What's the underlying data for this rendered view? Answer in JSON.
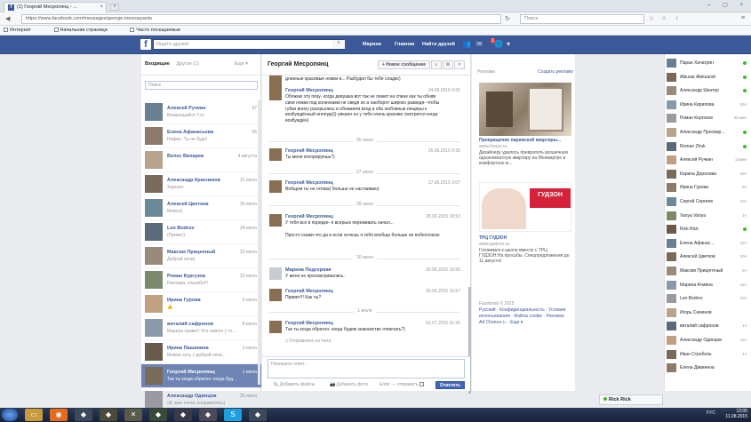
{
  "browser": {
    "tab_title": "(1) Георгий Месропянц - ...",
    "tab_close": "×",
    "new_tab": "+",
    "window_controls": "– ▢ ×",
    "url": "https://www.facebook.com/messages/george.mesropyants",
    "search_placeholder": "Поиск",
    "bookmarks": [
      "Интернет",
      "Начальная страница",
      "Часто посещаемые"
    ]
  },
  "fb": {
    "logo": "f",
    "search_placeholder": "Ищите друзей",
    "nav": [
      "Марина",
      "Главная",
      "Найти друзей"
    ],
    "notif_count": "1"
  },
  "inbox": {
    "tab_inbox": "Входящие",
    "tab_other": "Другое (1)",
    "more": "Еще ▾",
    "search_placeholder": "Поиск",
    "threads": [
      {
        "name": "Алексей Ручкин",
        "snippet": "Возвращайся 7-го",
        "date": "07"
      },
      {
        "name": "Елена Афанасьева",
        "snippet": "Нафис: Ты не будь!",
        "date": "06"
      },
      {
        "name": "Велес Вихарев",
        "snippet": "",
        "date": "4 августа"
      },
      {
        "name": "Александр Красников",
        "snippet": "Хорошо",
        "date": "31 июля"
      },
      {
        "name": "Алексей Цветков",
        "snippet": "Можно)",
        "date": "30 июля"
      },
      {
        "name": "Leo Bodrov",
        "snippet": "(Привет)",
        "date": "24 июля"
      },
      {
        "name": "Максим Прицепный",
        "snippet": "Доброй ночи)",
        "date": "23 июля"
      },
      {
        "name": "Роман Кургузов",
        "snippet": "Реклама, спасибо!!!",
        "date": "23 июля"
      },
      {
        "name": "Ирина Гурова",
        "snippet": "👍",
        "date": "9 июля"
      },
      {
        "name": "виталий сафронов",
        "snippet": "Марина привет! Что нового у те...",
        "date": "8 июля"
      },
      {
        "name": "Ирина Пашинина",
        "snippet": "Можно хоть с доброй ночи...",
        "date": "3 июля"
      },
      {
        "name": "Георгий Месропянц",
        "snippet": "Так ты когда обратно- когда буд...",
        "date": "1 июля"
      },
      {
        "name": "Александр Одинцов",
        "snippet": "ой, мне очень понравилось)",
        "date": "25 июня"
      }
    ]
  },
  "conversation": {
    "title": "Георгий Месропянц",
    "new_message": "+ Новое сообщение",
    "top_text": "длинные красивые ножки и... Разбудил бы тебя сладко)",
    "messages": [
      {
        "from": "Георгий Месропянц",
        "time": "24.06.2015 9:55",
        "text": "Обожаю эту позу- когда девушка вот так не лежит на спине как ты обняв свои ножки под коленками не сведя их а наоборот широко разведя- чтобы губки вниху раскрылись и обнажили вход в оба любовные пещеры к возбуждённый ингогда))) уверен он у тебя очень красиво смотрится когда возбуждён)"
      },
      {
        "from": "Георгий Месропянц",
        "time": "26.06.2015 9:35",
        "text": "Ты меня игнорируешь?)"
      },
      {
        "from": "Георгий Месропянц",
        "time": "27.06.2015 3:07",
        "text": "Вобщем ты не готова) больше не настаиваю)"
      },
      {
        "from": "Георгий Месропянц",
        "time": "28.06.2015 18:53",
        "text": "У тебя все в порядке- я всерьез переживать начал...\n\nПросто скажи что да и если хочешь я тебя вообще больше не побеспокою"
      },
      {
        "from": "Марина Подгорная",
        "time": "30.06.2015 16:50",
        "text": "У меня не просматривались."
      },
      {
        "from": "Георгий Месропянц",
        "time": "30.06.2015 16:57",
        "text": "Привет!!! Как ты?"
      },
      {
        "from": "Георгий Месропянц",
        "time": "01.07.2015 21:41",
        "text": "Так ты когда обратно- когда будем знакомство отмечать?)"
      }
    ],
    "separators": [
      "26 июня",
      "27 июня",
      "28 июня",
      "30 июня",
      "1 июля"
    ],
    "sent_from": "Отправлено из Чата",
    "compose_placeholder": "Напишите ответ...",
    "add_files": "Добавить файлы",
    "add_photo": "Добавить фото",
    "enter_send": "Enter — отправить",
    "send": "Ответить"
  },
  "ads": {
    "label": "Реклама",
    "create": "Создать рекламу",
    "ad1_title": "Превращение парижской квартиры...",
    "ad1_url": "www.houzz.ru",
    "ad1_text": "Дизайнеру удалось превратить крошечную однокомнатную квартиру на Монмартре в комфортное ж...",
    "ad2_brand": "ГУДЗОН",
    "ad2_title": "ТРЦ ГУДЗОН",
    "ad2_url": "www.gudzon.ru",
    "ad2_text": "Готовимся к школе вместе с ТРЦ ГУДЗОН.На просьбы. Спецпредложения до 11 августа!",
    "footer_copy": "Facebook © 2015",
    "footer_links": "Русский · Конфиденциальность · Условия использования · Файлы cookie · Реклама · Ad Choices ▷ · Еще ▾"
  },
  "chat": {
    "contacts": [
      {
        "name": "Паран Хачатрян",
        "status": "online"
      },
      {
        "name": "Albusar Aleksandr",
        "status": "online"
      },
      {
        "name": "Александр Шкатер",
        "status": "online"
      },
      {
        "name": "Ирина Кирилова",
        "status": "16ч"
      },
      {
        "name": "Роман Коргозов",
        "status": "35 мин"
      },
      {
        "name": "Александр Просвир...",
        "status": "online"
      },
      {
        "name": "Roman Zhuk",
        "status": "online"
      },
      {
        "name": "Алексей Ручкин",
        "status": "12мин"
      },
      {
        "name": "Карина Доронова",
        "status": "16ч"
      },
      {
        "name": "Ирина Гурова",
        "status": "6ч"
      },
      {
        "name": "Сергей Сергеев",
        "status": "10ч"
      },
      {
        "name": "Vanya Vanya",
        "status": "1ч"
      },
      {
        "name": "Rick Rick",
        "status": "online"
      },
      {
        "name": "Елена Афанас...",
        "status": "12ч"
      },
      {
        "name": "Алексей Цветков",
        "status": "10ч"
      },
      {
        "name": "Максим Прицептный",
        "status": "5ч"
      },
      {
        "name": "Марина Атмина",
        "status": "16ч"
      },
      {
        "name": "Leo Bodrov",
        "status": "10ч"
      },
      {
        "name": "Игорь Семенов",
        "status": ""
      },
      {
        "name": "виталий сафронов",
        "status": "1ч"
      },
      {
        "name": "Александр Одинцов",
        "status": "12ч"
      },
      {
        "name": "Иван Строболь",
        "status": "1ч"
      },
      {
        "name": "Елена Дивинена",
        "status": ""
      }
    ],
    "bar_name": "Rick Rick"
  },
  "taskbar": {
    "tray": "РУС",
    "time": "12:05",
    "date": "11.08.2015"
  }
}
